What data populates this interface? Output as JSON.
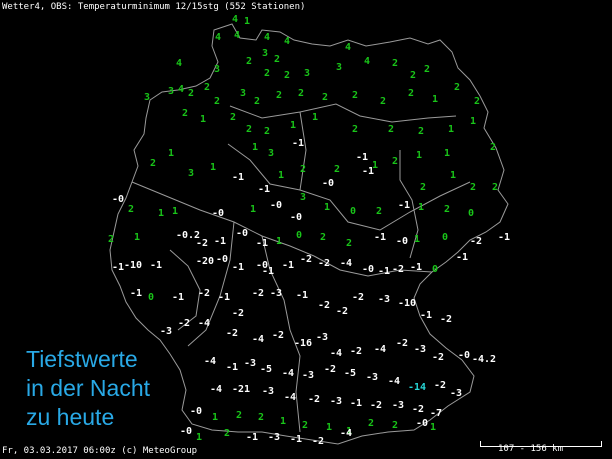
{
  "header": {
    "text": "Wetter4, OBS: Temperaturminimum 12/15stg (552 Stationen)"
  },
  "footer": {
    "text": "Fr, 03.03.2017 06:00z (c) MeteoGroup"
  },
  "overlay": {
    "line1": "Tiefstwerte",
    "line2": "in der Nacht",
    "line3": "zu heute"
  },
  "scale": {
    "label": "107 - 156 km"
  },
  "colors": {
    "positive": "#19c419",
    "negative": "#ffffff",
    "minimum": "#27d6d6",
    "border": "#9a9a9a",
    "overlay": "#29a9e6"
  },
  "stations": [
    {
      "v": "4"
    },
    {
      "v": "1"
    },
    {
      "v": "4"
    },
    {
      "v": "4"
    },
    {
      "v": "4"
    },
    {
      "v": "4"
    },
    {
      "v": "4"
    },
    {
      "v": "3"
    },
    {
      "v": "2"
    },
    {
      "v": "2"
    },
    {
      "v": "4"
    },
    {
      "v": "3"
    },
    {
      "v": "2"
    },
    {
      "v": "2"
    },
    {
      "v": "3"
    },
    {
      "v": "4"
    },
    {
      "v": "3"
    },
    {
      "v": "2"
    },
    {
      "v": "2"
    },
    {
      "v": "2"
    },
    {
      "v": "3"
    },
    {
      "v": "3"
    },
    {
      "v": "4"
    },
    {
      "v": "2"
    },
    {
      "v": "2"
    },
    {
      "v": "2"
    },
    {
      "v": "3"
    },
    {
      "v": "2"
    },
    {
      "v": "2"
    },
    {
      "v": "2"
    },
    {
      "v": "2"
    },
    {
      "v": "2"
    },
    {
      "v": "2"
    },
    {
      "v": "2"
    },
    {
      "v": "1"
    },
    {
      "v": "2"
    },
    {
      "v": "2"
    },
    {
      "v": "2"
    },
    {
      "v": "1"
    },
    {
      "v": "2"
    },
    {
      "v": "2"
    },
    {
      "v": "2"
    },
    {
      "v": "1"
    },
    {
      "v": "1"
    },
    {
      "v": "2"
    },
    {
      "v": "2"
    },
    {
      "v": "2"
    },
    {
      "v": "1"
    },
    {
      "v": "1"
    },
    {
      "v": "-1"
    },
    {
      "v": "1"
    },
    {
      "v": "3"
    },
    {
      "v": "-1"
    },
    {
      "v": "2"
    },
    {
      "v": "1"
    },
    {
      "v": "2"
    },
    {
      "v": "1"
    },
    {
      "v": "1"
    },
    {
      "v": "-1"
    },
    {
      "v": "2"
    },
    {
      "v": "1"
    },
    {
      "v": "2"
    },
    {
      "v": "3"
    },
    {
      "v": "1"
    },
    {
      "v": "-1"
    },
    {
      "v": "-1"
    },
    {
      "v": "2"
    },
    {
      "v": "1"
    },
    {
      "v": "-0"
    },
    {
      "v": "2"
    },
    {
      "v": "1"
    },
    {
      "v": "2"
    },
    {
      "v": "2"
    },
    {
      "v": "-0"
    },
    {
      "v": "2"
    },
    {
      "v": "1"
    },
    {
      "v": "1"
    },
    {
      "v": "-0"
    },
    {
      "v": "1"
    },
    {
      "v": "3"
    },
    {
      "v": "1"
    },
    {
      "v": "0"
    },
    {
      "v": "2"
    },
    {
      "v": "-1"
    },
    {
      "v": "1"
    },
    {
      "v": "2"
    },
    {
      "v": "0"
    },
    {
      "v": "-0"
    },
    {
      "v": "-0"
    },
    {
      "v": "2"
    },
    {
      "v": "1"
    },
    {
      "v": "-0.2"
    },
    {
      "v": "-2"
    },
    {
      "v": "-1"
    },
    {
      "v": "-0"
    },
    {
      "v": "-1"
    },
    {
      "v": "1"
    },
    {
      "v": "0"
    },
    {
      "v": "2"
    },
    {
      "v": "2"
    },
    {
      "v": "-1"
    },
    {
      "v": "-0"
    },
    {
      "v": "1"
    },
    {
      "v": "0"
    },
    {
      "v": "-2"
    },
    {
      "v": "-1"
    },
    {
      "v": "-1"
    },
    {
      "v": "-10"
    },
    {
      "v": "-1"
    },
    {
      "v": "-20"
    },
    {
      "v": "-0"
    },
    {
      "v": "-1"
    },
    {
      "v": "-0"
    },
    {
      "v": "-1"
    },
    {
      "v": "-1"
    },
    {
      "v": "-2"
    },
    {
      "v": "-2"
    },
    {
      "v": "-4"
    },
    {
      "v": "-0"
    },
    {
      "v": "-1"
    },
    {
      "v": "-2"
    },
    {
      "v": "-1"
    },
    {
      "v": "0"
    },
    {
      "v": "-1"
    },
    {
      "v": "-1"
    },
    {
      "v": "0"
    },
    {
      "v": "-1"
    },
    {
      "v": "-2"
    },
    {
      "v": "-1"
    },
    {
      "v": "-2"
    },
    {
      "v": "-2"
    },
    {
      "v": "-3"
    },
    {
      "v": "-1"
    },
    {
      "v": "-2"
    },
    {
      "v": "-2"
    },
    {
      "v": "-2"
    },
    {
      "v": "-3"
    },
    {
      "v": "-10"
    },
    {
      "v": "-1"
    },
    {
      "v": "-2"
    },
    {
      "v": "-3"
    },
    {
      "v": "-2"
    },
    {
      "v": "-4"
    },
    {
      "v": "-2"
    },
    {
      "v": "-4"
    },
    {
      "v": "-2"
    },
    {
      "v": "-16"
    },
    {
      "v": "-3"
    },
    {
      "v": "-4"
    },
    {
      "v": "-2"
    },
    {
      "v": "-4"
    },
    {
      "v": "-2"
    },
    {
      "v": "-3"
    },
    {
      "v": "-2"
    },
    {
      "v": "-0"
    },
    {
      "v": "-4.2"
    },
    {
      "v": "-4"
    },
    {
      "v": "-1"
    },
    {
      "v": "-3"
    },
    {
      "v": "-5"
    },
    {
      "v": "-4"
    },
    {
      "v": "-3"
    },
    {
      "v": "-2"
    },
    {
      "v": "-5"
    },
    {
      "v": "-3"
    },
    {
      "v": "-4"
    },
    {
      "v": "-14",
      "min": true
    },
    {
      "v": "-2"
    },
    {
      "v": "-3"
    },
    {
      "v": "-4"
    },
    {
      "v": "-21"
    },
    {
      "v": "-3"
    },
    {
      "v": "-4"
    },
    {
      "v": "-2"
    },
    {
      "v": "-3"
    },
    {
      "v": "-1"
    },
    {
      "v": "-2"
    },
    {
      "v": "-3"
    },
    {
      "v": "-2"
    },
    {
      "v": "-7"
    },
    {
      "v": "-0"
    },
    {
      "v": "1"
    },
    {
      "v": "2"
    },
    {
      "v": "2"
    },
    {
      "v": "1"
    },
    {
      "v": "2"
    },
    {
      "v": "1"
    },
    {
      "v": "1"
    },
    {
      "v": "2"
    },
    {
      "v": "2"
    },
    {
      "v": "-0"
    },
    {
      "v": "1"
    },
    {
      "v": "-0"
    },
    {
      "v": "1"
    },
    {
      "v": "2"
    },
    {
      "v": "-1"
    },
    {
      "v": "-3"
    },
    {
      "v": "-1"
    },
    {
      "v": "-2"
    },
    {
      "v": "-4"
    }
  ]
}
